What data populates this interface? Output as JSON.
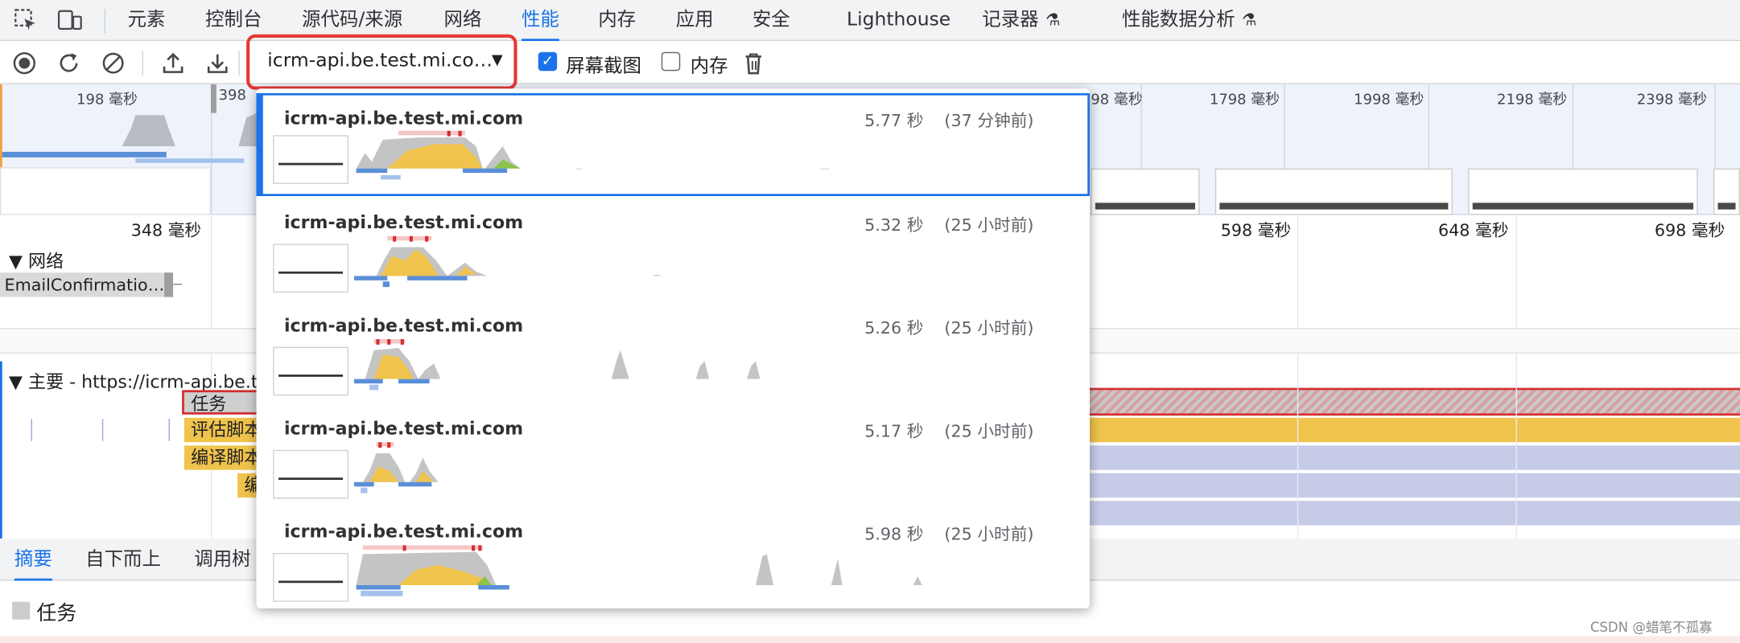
{
  "tabs": [
    "元素",
    "控制台",
    "源代码/来源",
    "网络",
    "性能",
    "内存",
    "应用",
    "安全",
    "Lighthouse",
    "记录器",
    "性能数据分析"
  ],
  "active_tab": "性能",
  "experimental_icon": "flask-icon",
  "toolbar": {
    "icons": [
      "record-icon",
      "reload-icon",
      "clear-icon",
      "upload-icon",
      "download-icon",
      "trash-icon"
    ],
    "recording_select": "icrm-api.be.test.mi.co…",
    "screenshots_label": "屏幕截图",
    "screenshots_checked": true,
    "memory_label": "内存",
    "memory_checked": false
  },
  "overview_ticks": [
    "198 毫秒",
    "398",
    "98 毫秒",
    "1798 毫秒",
    "1998 毫秒",
    "2198 毫秒",
    "2398 毫秒"
  ],
  "ruler_ticks": [
    "348 毫秒",
    "598 毫秒",
    "648 毫秒",
    "698 毫秒"
  ],
  "network": {
    "title": "网络",
    "request": "EmailConfirmatio…"
  },
  "main_thread": {
    "title": "主要 - https://icrm-api.be.tes",
    "task": "任务",
    "evaluate": "评估脚本",
    "compile": "编译脚本",
    "compile_short": "编"
  },
  "bottom_tabs": [
    "摘要",
    "自下而上",
    "调用树"
  ],
  "summary_label": "任务",
  "watermark": "CSDN @蜡笔不孤寡",
  "recordings": [
    {
      "name": "icrm-api.be.test.mi.com",
      "duration": "5.77 秒",
      "ago": "(37 分钟前)",
      "selected": true
    },
    {
      "name": "icrm-api.be.test.mi.com",
      "duration": "5.32 秒",
      "ago": "(25 小时前)",
      "selected": false
    },
    {
      "name": "icrm-api.be.test.mi.com",
      "duration": "5.26 秒",
      "ago": "(25 小时前)",
      "selected": false
    },
    {
      "name": "icrm-api.be.test.mi.com",
      "duration": "5.17 秒",
      "ago": "(25 小时前)",
      "selected": false
    },
    {
      "name": "icrm-api.be.test.mi.com",
      "duration": "5.98 秒",
      "ago": "(25 小时前)",
      "selected": false
    }
  ],
  "colors": {
    "accent": "#1a73e8",
    "highlight": "#e53935",
    "scripting": "#f0c34c",
    "network": "#5a8fd8",
    "idle": "#c6cbe8",
    "task": "#d9a0a0"
  }
}
